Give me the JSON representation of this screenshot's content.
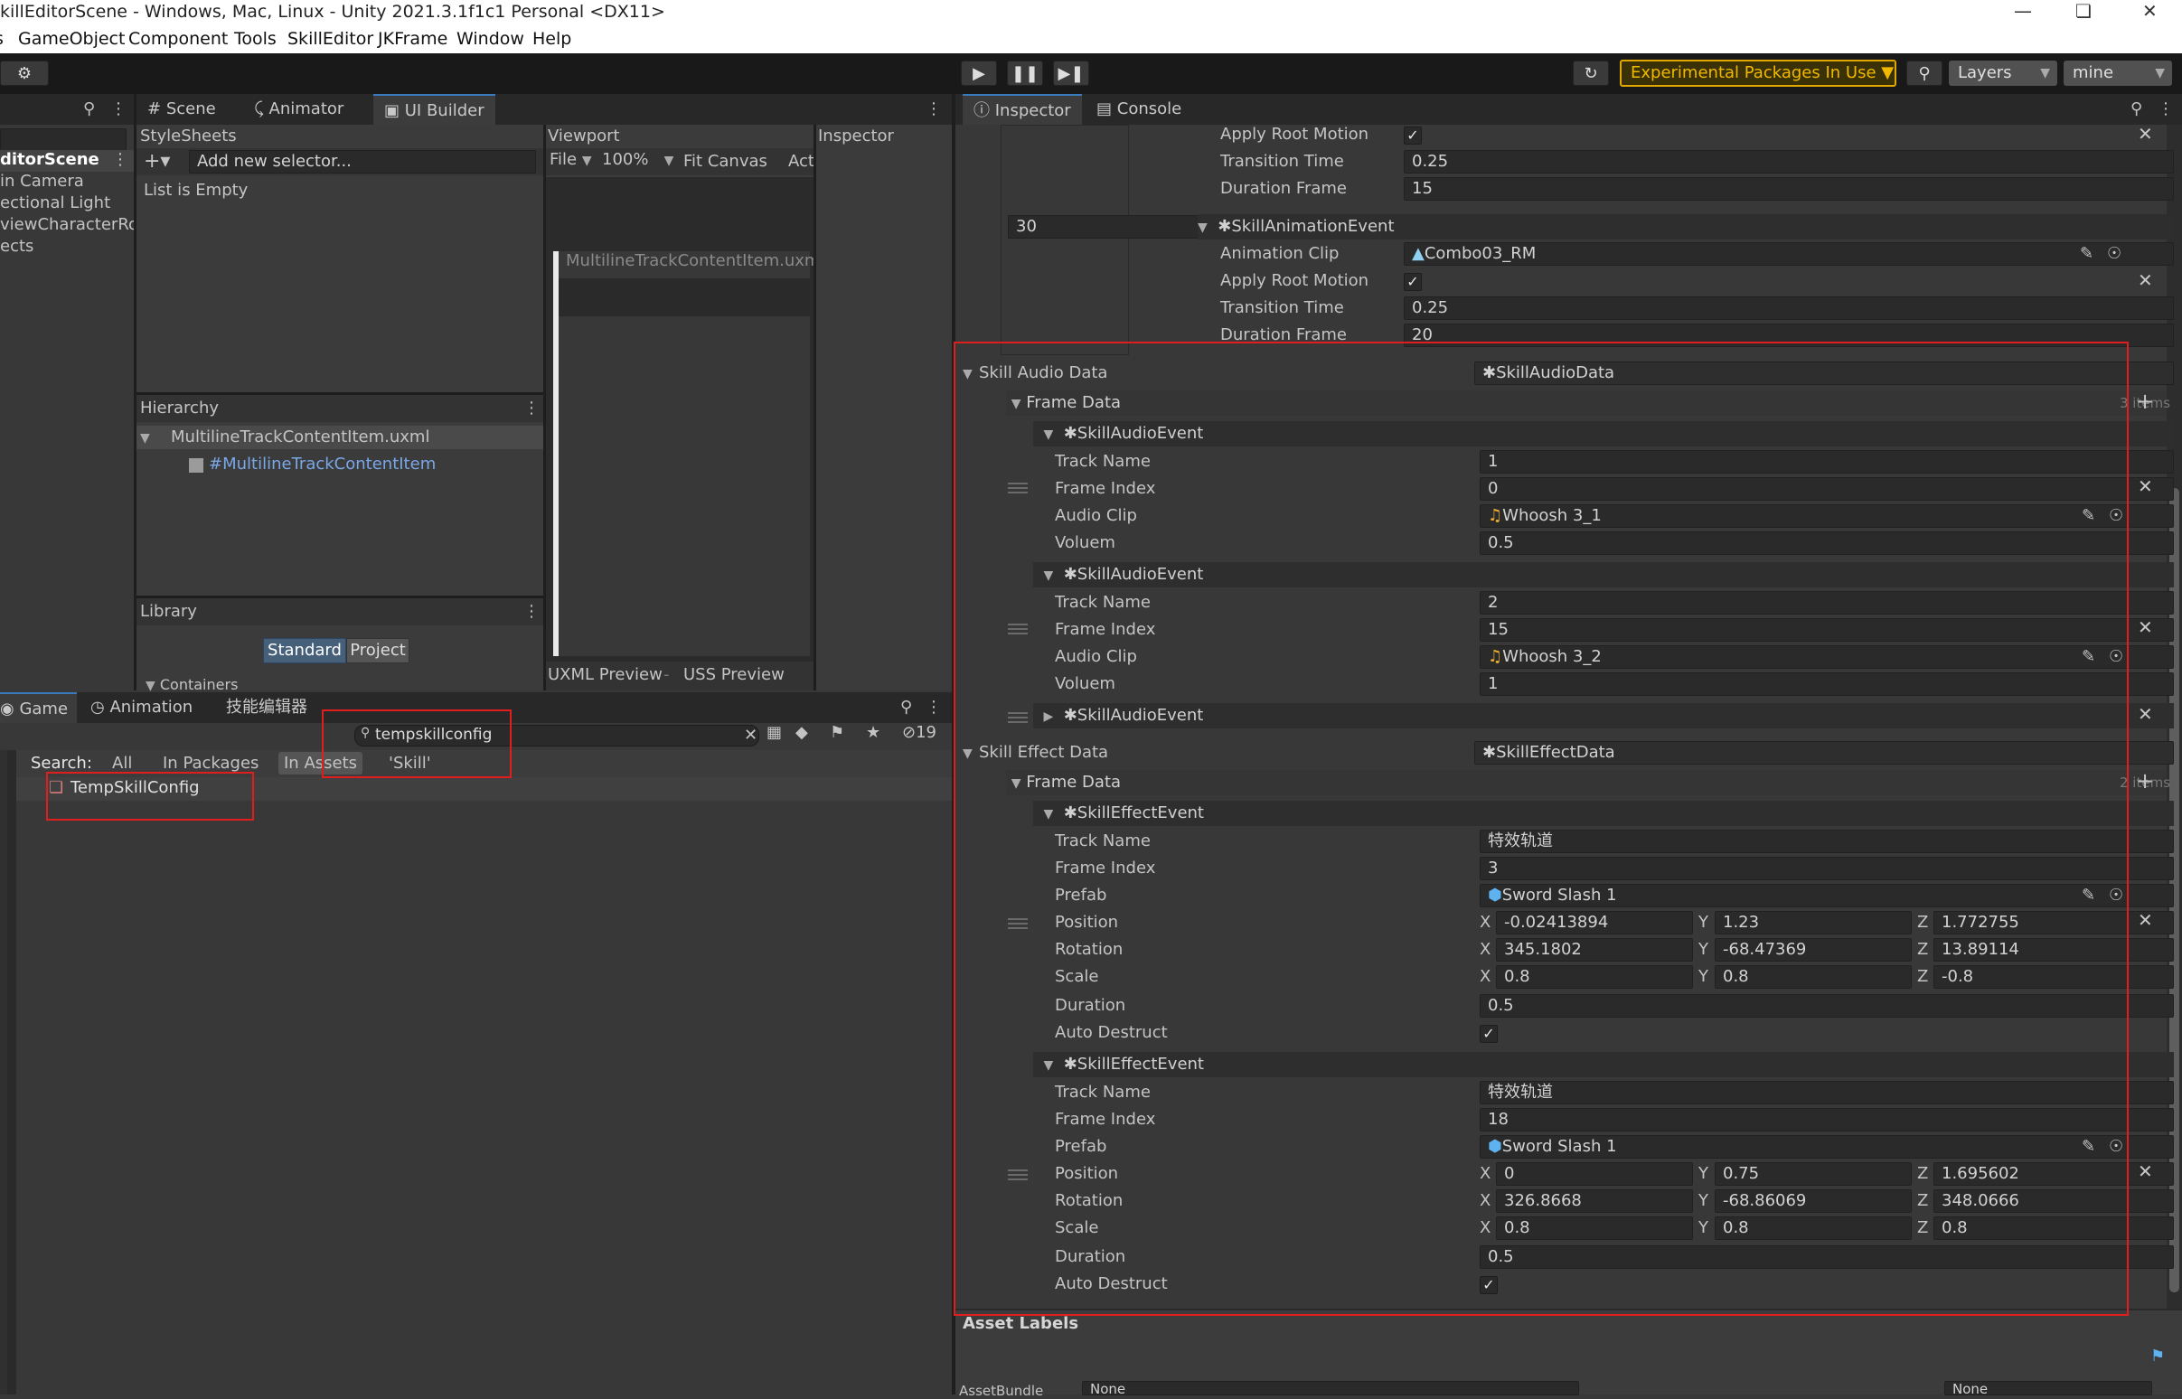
{
  "window": {
    "title": "killEditorScene - Windows, Mac, Linux - Unity 2021.3.1f1c1 Personal <DX11>"
  },
  "menu": [
    "GameObject",
    "Component",
    "Tools",
    "SkillEditor",
    "JKFrame",
    "Window",
    "Help"
  ],
  "toolbar": {
    "experimental": "Experimental Packages In Use ▼",
    "layers": "Layers",
    "layout": "mine"
  },
  "hierarchy_panel": {
    "scene": "ditorScene",
    "items": [
      "in Camera",
      "ectional Light",
      "viewCharacterRo",
      "ects"
    ]
  },
  "center_tabs": [
    "Scene",
    "Animator",
    "UI Builder"
  ],
  "uibuilder": {
    "stylesheets_title": "StyleSheets",
    "add_selector_placeholder": "Add new selector...",
    "list_empty": "List is Empty",
    "viewport_title": "Viewport",
    "file_menu": "File",
    "zoom": "100%",
    "fit_canvas": "Fit Canvas",
    "act": "Act",
    "canvas_doc": "MultilineTrackContentItem.uxml",
    "inspector_title": "Inspector",
    "hierarchy_title": "Hierarchy",
    "hierarchy_file": "MultilineTrackContentItem.uxml",
    "hierarchy_element": "#MultilineTrackContentItem",
    "library_title": "Library",
    "library_standard": "Standard",
    "library_project": "Project",
    "library_containers": "Containers",
    "uxml_preview": "UXML Preview",
    "uss_preview": "USS Preview"
  },
  "bottom_panel": {
    "tabs": [
      "Game",
      "Animation",
      "技能编辑器"
    ],
    "search_value": "tempskillconfig",
    "hidden_count": "19",
    "search_label": "Search:",
    "filters": [
      "All",
      "In Packages",
      "In Assets",
      "'Skill'"
    ],
    "result": "TempSkillConfig"
  },
  "inspector": {
    "tabs": [
      "Inspector",
      "Console"
    ],
    "anim_top": {
      "apply_root_motion_label": "Apply Root Motion",
      "transition_label": "Transition Time",
      "transition_value": "0.25",
      "duration_label": "Duration Frame",
      "duration_value": "15"
    },
    "anim_event2": {
      "key": "30",
      "header": "✱SkillAnimationEvent",
      "clip_label": "Animation Clip",
      "clip_value": "Combo03_RM",
      "apply_root_motion_label": "Apply Root Motion",
      "transition_label": "Transition Time",
      "transition_value": "0.25",
      "duration_label": "Duration Frame",
      "duration_value": "20"
    },
    "audio": {
      "title": "Skill Audio Data",
      "type": "✱SkillAudioData",
      "frame_data": "Frame Data",
      "count": "3 items",
      "events": [
        {
          "header": "✱SkillAudioEvent",
          "track_label": "Track Name",
          "track": "1",
          "frame_label": "Frame Index",
          "frame": "0",
          "clip_label": "Audio Clip",
          "clip": "Whoosh 3_1",
          "vol_label": "Voluem",
          "vol": "0.5"
        },
        {
          "header": "✱SkillAudioEvent",
          "track_label": "Track Name",
          "track": "2",
          "frame_label": "Frame Index",
          "frame": "15",
          "clip_label": "Audio Clip",
          "clip": "Whoosh 3_2",
          "vol_label": "Voluem",
          "vol": "1"
        }
      ],
      "collapsed_event": "✱SkillAudioEvent"
    },
    "effect": {
      "title": "Skill Effect Data",
      "type": "✱SkillEffectData",
      "frame_data": "Frame Data",
      "count": "2 items",
      "labels": {
        "track": "Track Name",
        "frame": "Frame Index",
        "prefab": "Prefab",
        "pos": "Position",
        "rot": "Rotation",
        "scale": "Scale",
        "dur": "Duration",
        "auto": "Auto Destruct"
      },
      "events": [
        {
          "header": "✱SkillEffectEvent",
          "track": "特效轨道",
          "frame": "3",
          "prefab": "Sword Slash 1",
          "pos": {
            "x": "-0.02413894",
            "y": "1.23",
            "z": "1.772755"
          },
          "rot": {
            "x": "345.1802",
            "y": "-68.47369",
            "z": "13.89114"
          },
          "scale": {
            "x": "0.8",
            "y": "0.8",
            "z": "-0.8"
          },
          "dur": "0.5"
        },
        {
          "header": "✱SkillEffectEvent",
          "track": "特效轨道",
          "frame": "18",
          "prefab": "Sword Slash 1",
          "pos": {
            "x": "0",
            "y": "0.75",
            "z": "1.695602"
          },
          "rot": {
            "x": "326.8668",
            "y": "-68.86069",
            "z": "348.0666"
          },
          "scale": {
            "x": "0.8",
            "y": "0.8",
            "z": "0.8"
          },
          "dur": "0.5"
        }
      ]
    },
    "asset_labels": "Asset Labels",
    "asset_bundle": "AssetBundle",
    "none1": "None",
    "none2": "None"
  },
  "colors": {
    "accent": "#3a79bb",
    "highlight": "#e01e1e",
    "warning": "#f2b800"
  }
}
